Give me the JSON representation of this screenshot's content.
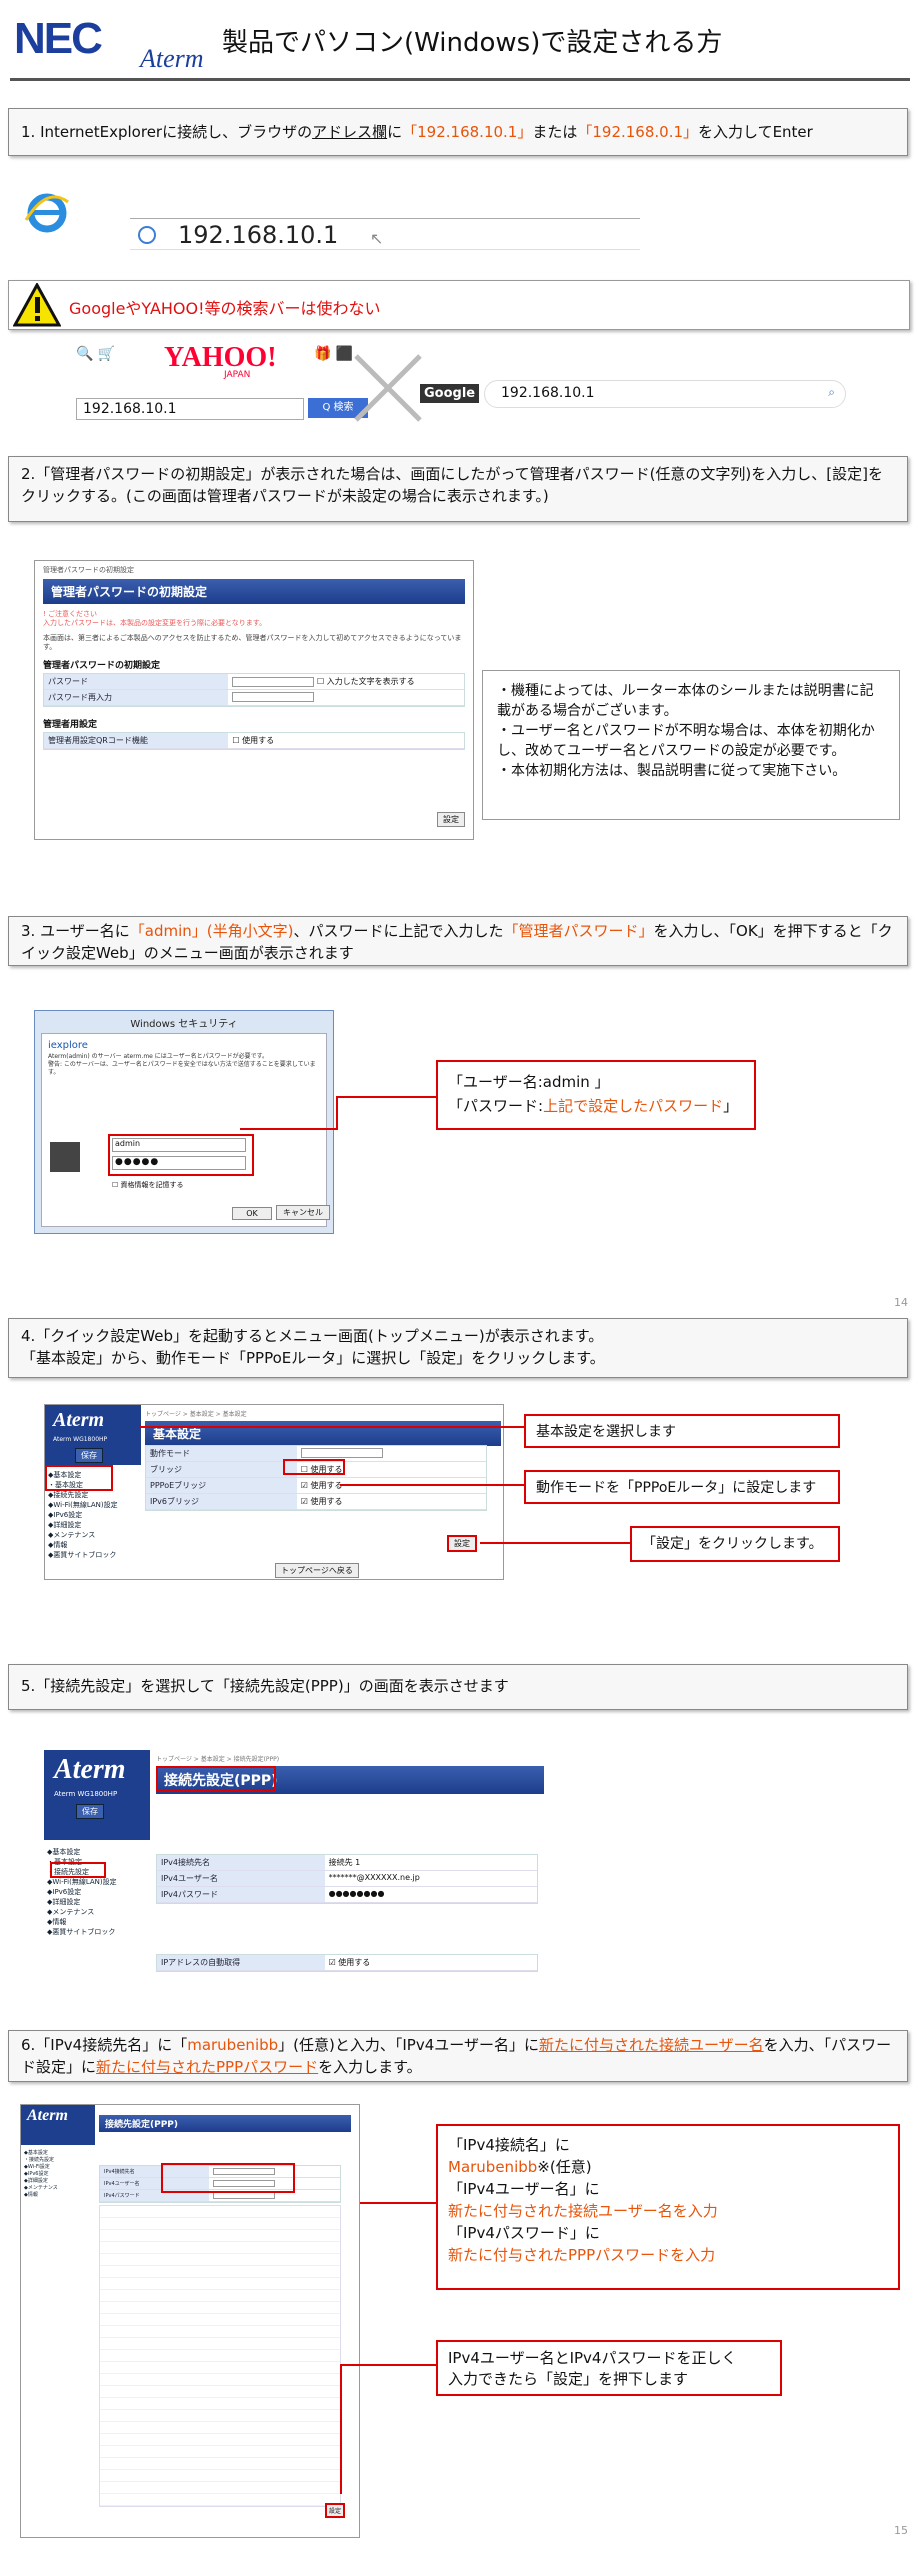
{
  "header": {
    "brand_nec": "NEC",
    "brand_aterm": "Aterm",
    "title": "製品でパソコン(Windows)で設定される方"
  },
  "step1": {
    "prefix": "1.  InternetExplorerに接続し、ブラウザの",
    "address_bar": "アドレス欄",
    "mid1": "に",
    "ip1": "「192.168.10.1」",
    "mid2": "または",
    "ip2": "「192.168.0.1」",
    "suffix": "を入力してEnter",
    "url": "192.168.10.1"
  },
  "warning": {
    "text": "GoogleやYAHOO!等の検索バーは使わない",
    "yahoo_logo": "YAHOO!",
    "yahoo_sub": "JAPAN",
    "yahoo_search_value": "192.168.10.1",
    "yahoo_search_btn": "Q 検索",
    "google_logo": "Google",
    "google_search_value": "192.168.10.1"
  },
  "step2": {
    "text": "2.「管理者パスワードの初期設定」が表示された場合は、画面にしたがって管理者パスワード(任意の文字列)を入力し、[設定]をクリックする。(この画面は管理者パスワードが未設定の場合に表示されます。)",
    "dialog_title": "管理者パスワードの初期設定",
    "label_pw": "パスワード",
    "label_pw2": "パスワード再入力",
    "show_chars": "入力した文字を表示する",
    "use": "使用する",
    "set_btn": "設定",
    "note": "・機種によっては、ルーター本体のシールまたは説明書に記載がある場合がございます。\n・ユーザー名とパスワードが不明な場合は、本体を初期化かし、改めてユーザー名とパスワードの設定が必要です。\n・本体初期化方法は、製品説明書に従って実施下さい。"
  },
  "step3": {
    "prefix": "3.  ユーザー名に",
    "user": "「admin」(半角小文字)",
    "mid": "、パスワードに上記で入力した",
    "pw": "「管理者パスワード」",
    "suffix": "を入力し、「OK」を押下すると「クイック設定Web」のメニュー画面が表示されます",
    "dialog_title": "Windows セキュリティ",
    "dialog_app": "iexplore",
    "username_value": "admin",
    "password_value": "●●●●●",
    "remember": "資格情報を記憶する",
    "ok": "OK",
    "cancel": "キャンセル",
    "callout_line1": "「ユーザー名:admin 」",
    "callout_line2_prefix": "「パスワード:",
    "callout_line2_orange": "上記で設定したパスワード",
    "callout_line2_suffix": "」"
  },
  "page14": "14",
  "step4": {
    "line1": "4.「クイック設定Web」を起動するとメニュー画面(トップメニュー)が表示されます。",
    "line2": "「基本設定」から、動作モード「PPPoEルータ」に選択し「設定」をクリックします。",
    "logo": "Aterm",
    "model": "Aterm WG1800HP",
    "save": "保存",
    "panel_title": "基本設定",
    "callout1": "基本設定を選択します",
    "callout2": "動作モードを「PPPoEルータ」に設定します",
    "callout3": "「設定」をクリックします。"
  },
  "step5": {
    "text": "5.「接続先設定」を選択して「接続先設定(PPP)」の画面を表示させます",
    "logo": "Aterm",
    "model": "Aterm WG1800HP",
    "save": "保存",
    "panel_title": "接続先設定(PPP)",
    "menu_basic": "基本設定",
    "menu_conn": "接続先設定",
    "conn_name_label": "IPv4接続先名",
    "conn_name_value": "接続先 1",
    "user_label": "IPv4ユーザー名",
    "user_value": "*******@XXXXXX.ne.jp",
    "pw_label": "IPv4パスワード",
    "pw_value": "●●●●●●●●"
  },
  "step6": {
    "p1": "6.「IPv4接続先名」に「",
    "name": "marubenibb",
    "p2": "」(任意)と入力、「IPv4ユーザー名」に",
    "user": "新たに付与された接続ユーザー名",
    "p3": "を入力、「パスワード設定」に",
    "pw": "新たに付与されたPPPパスワード",
    "p4": "を入力します。",
    "logo": "Aterm",
    "panel_title": "接続先設定(PPP)",
    "callout_a1": "「IPv4接続名」に",
    "callout_a2": "Marubenibb",
    "callout_a2b": "※(任意)",
    "callout_a3": "「IPv4ユーザー名」に",
    "callout_a4": "新たに付与された接続ユーザー名を入力",
    "callout_a5": "「IPv4パスワード」に",
    "callout_a6": "新たに付与されたPPPパスワードを入力",
    "callout_b1": "IPv4ユーザー名とIPv4パスワードを正しく",
    "callout_b2": "入力できたら「設定」を押下します",
    "set_btn": "設定"
  },
  "page15": "15"
}
